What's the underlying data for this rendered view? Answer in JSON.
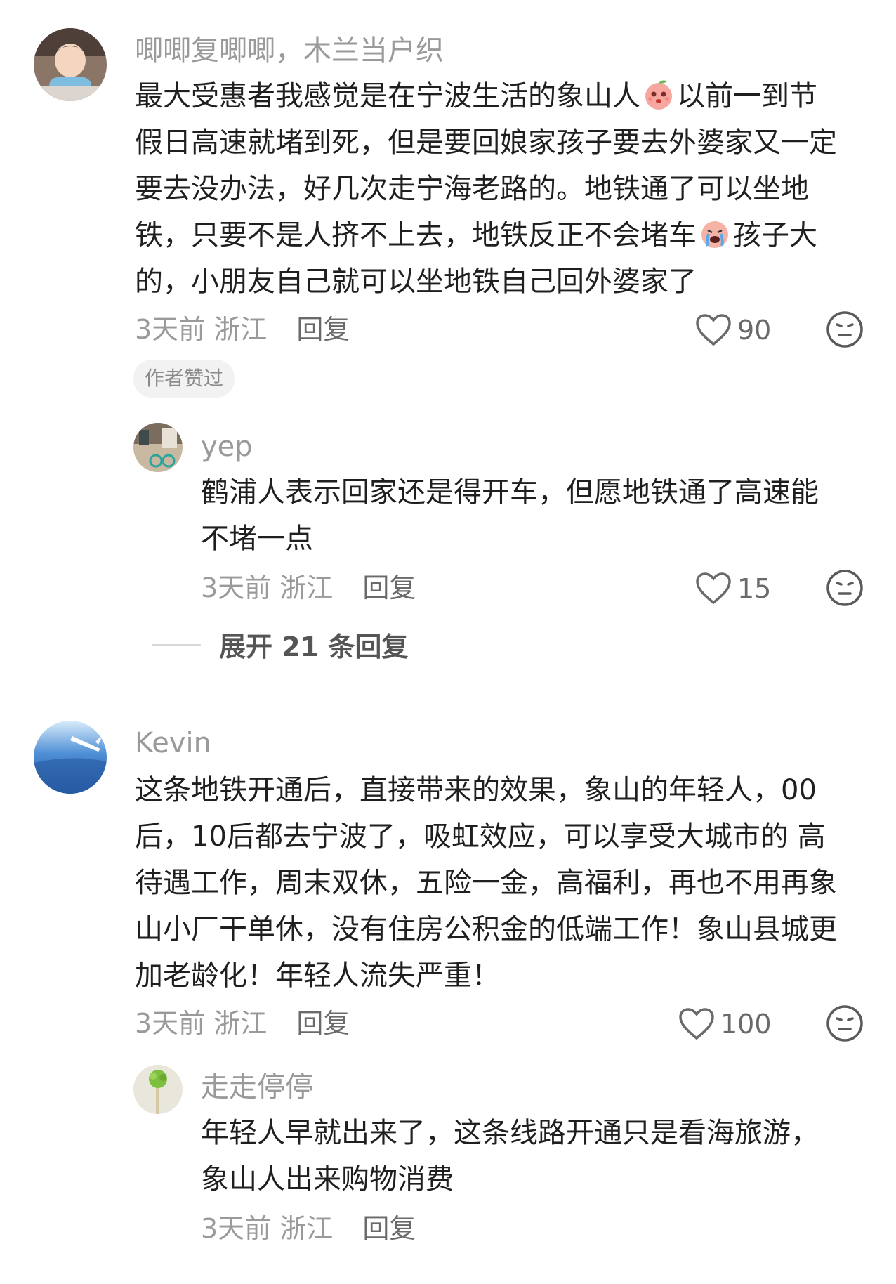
{
  "comments": [
    {
      "username": "唧唧复唧唧，木兰当户织",
      "lines": [
        "最大受惠者我感觉是在宁波生活的象山人",
        "以前一到节",
        "假日高速就堵到死，但是要回娘家孩子要去外婆家又一定",
        "要去没办法，好几次走宁海老路的。地铁通了可以坐地",
        "铁，只要不是人挤不上去，地铁反正不会堵车",
        "孩子大",
        "的，小朋友自己就可以坐地铁自己回外婆家了"
      ],
      "time": "3天前",
      "location": "浙江",
      "reply_label": "回复",
      "likes": "90",
      "badge": "作者赞过",
      "emoji_1": "peach-emoji",
      "emoji_2": "crying-emoji"
    },
    {
      "username": "yep",
      "lines": [
        "鹤浦人表示回家还是得开车，但愿地铁通了高速能",
        "不堵一点"
      ],
      "time": "3天前",
      "location": "浙江",
      "reply_label": "回复",
      "likes": "15"
    },
    {
      "username": "Kevin",
      "lines": [
        "这条地铁开通后，直接带来的效果，象山的年轻人，00",
        "后，10后都去宁波了，吸虹效应，可以享受大城市的 高",
        "待遇工作，周末双休，五险一金，高福利，再也不用再象",
        "山小厂干单休，没有住房公积金的低端工作！象山县城更",
        "加老龄化！年轻人流失严重！"
      ],
      "time": "3天前",
      "location": "浙江",
      "reply_label": "回复",
      "likes": "100"
    },
    {
      "username": "走走停停",
      "lines": [
        "年轻人早就出来了，这条线路开通只是看海旅游，",
        "象山人出来购物消费"
      ],
      "time": "3天前",
      "location": "浙江",
      "reply_label": "回复"
    }
  ],
  "expand_replies": "展开 21 条回复",
  "icons": {
    "like": "heart-outline-icon",
    "dislike": "neutral-face-icon"
  },
  "colors": {
    "text": "#1f1f1f",
    "muted": "#9a9a9a",
    "badge_bg": "#f2f2f2"
  }
}
